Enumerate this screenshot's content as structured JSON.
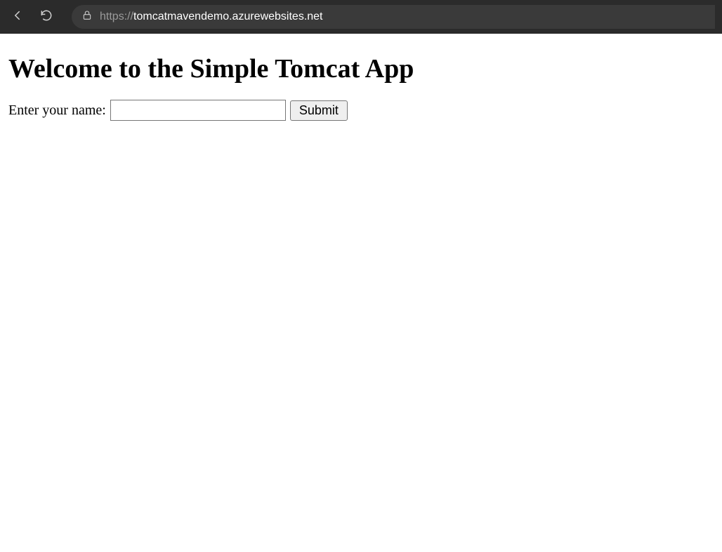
{
  "browser": {
    "url_scheme": "https://",
    "url_domain": "tomcatmavendemo.azurewebsites.net",
    "url_path": ""
  },
  "page": {
    "heading": "Welcome to the Simple Tomcat App",
    "form": {
      "name_label": "Enter your name:",
      "name_value": "",
      "name_placeholder": "",
      "submit_label": "Submit"
    }
  }
}
